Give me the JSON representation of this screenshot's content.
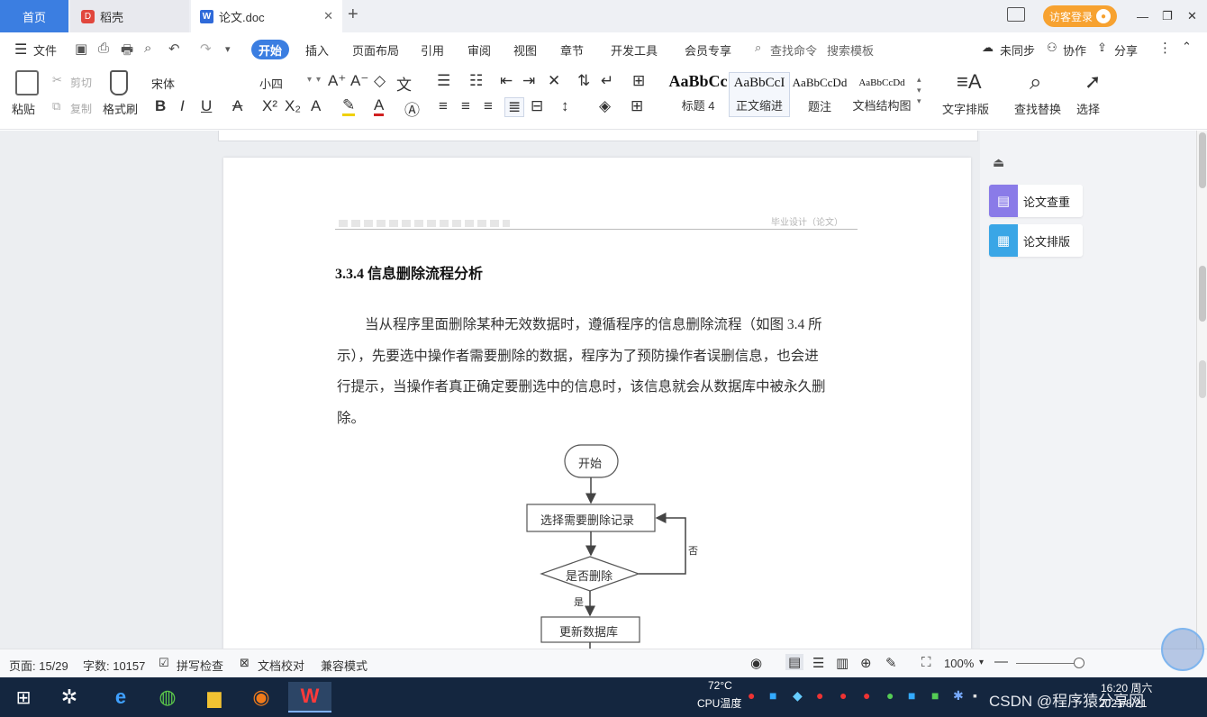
{
  "tabs": {
    "home": "首页",
    "docer": "稻壳",
    "doc": "论文.doc"
  },
  "window": {
    "login": "访客登录",
    "minimize": "—",
    "restore": "❐",
    "close": "✕"
  },
  "menu": {
    "file": "文件",
    "items": [
      "开始",
      "插入",
      "页面布局",
      "引用",
      "审阅",
      "视图",
      "章节",
      "开发工具",
      "会员专享"
    ],
    "search": "查找命令",
    "template": "搜索模板",
    "sync": "未同步",
    "collab": "协作",
    "share": "分享"
  },
  "ribbon": {
    "paste": "粘贴",
    "cut": "剪切",
    "copy": "复制",
    "format_painter": "格式刷",
    "font_name": "宋体",
    "font_size": "小四",
    "styles": [
      {
        "preview": "AaBbCc",
        "label": "标题 4"
      },
      {
        "preview": "AaBbCcI",
        "label": "正文缩进"
      },
      {
        "preview": "AaBbCcDd",
        "label": "题注"
      },
      {
        "preview": "AaBbCcDd",
        "label": "文档结构图"
      }
    ],
    "text_layout": "文字排版",
    "find_replace": "查找替换",
    "select": "选择"
  },
  "document": {
    "header_right": "毕业设计（论文）",
    "section_heading": "3.3.4  信息删除流程分析",
    "paragraph_lines": [
      "当从程序里面删除某种无效数据时，遵循程序的信息删除流程（如图 3.4 所",
      "示），先要选中操作者需要删除的数据，程序为了预防操作者误删信息，也会进",
      "行提示，当操作者真正确定要删选中的信息时，该信息就会从数据库中被永久删",
      "除。"
    ],
    "flowchart": {
      "start": "开始",
      "select_record": "选择需要删除记录",
      "decision": "是否删除",
      "no": "否",
      "yes": "是",
      "update": "更新数据库"
    }
  },
  "side_panel": {
    "check": "论文查重",
    "layout": "论文排版"
  },
  "status": {
    "page": "页面: 15/29",
    "words": "字数: 10157",
    "spell": "拼写检查",
    "proof": "文档校对",
    "compat": "兼容模式",
    "zoom": "100%"
  },
  "taskbar": {
    "cpu_temp": "72°C",
    "cpu_label": "CPU温度",
    "time": "16:20 周六",
    "date": "2021/8/21",
    "watermark": "CSDN @程序猿分享网"
  },
  "colors": {
    "accent": "#3b7ee1",
    "login": "#f7a230",
    "taskbar": "#14263f",
    "workspace": "#eceef1"
  }
}
